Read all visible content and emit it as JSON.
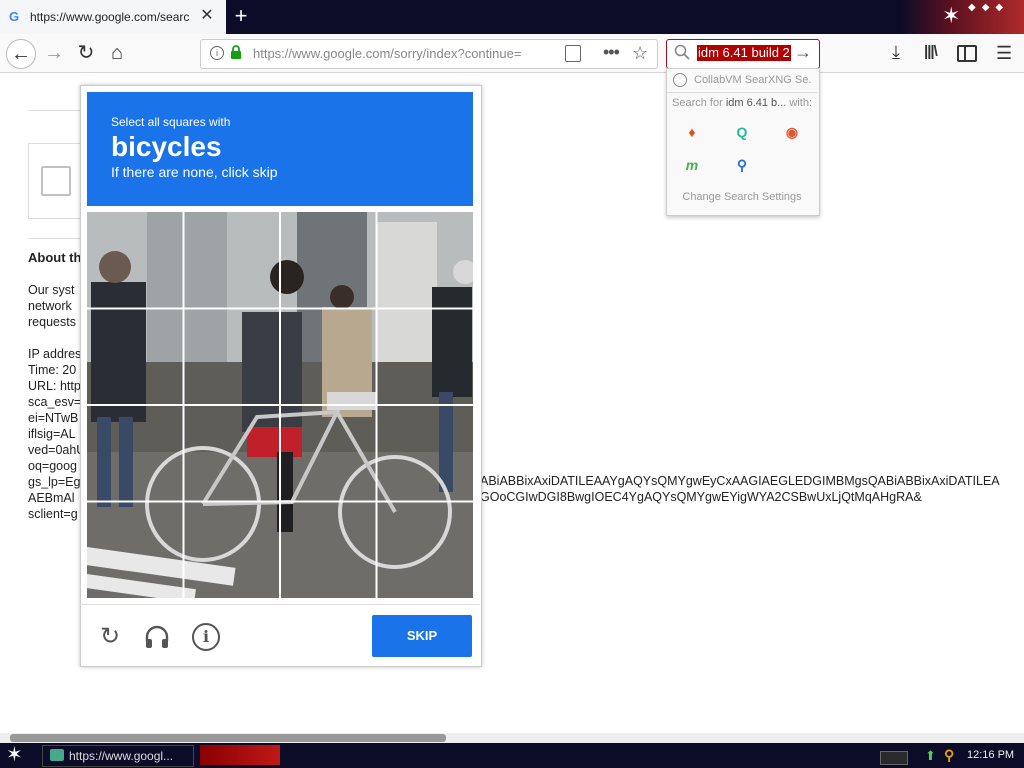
{
  "browser": {
    "tab": {
      "title": "https://www.google.com/search?",
      "favicon": "G",
      "close_label": "✕"
    },
    "new_tab_label": "+",
    "url": "https://www.google.com/sorry/index?continue=",
    "search_box": {
      "value": "idm 6.41 build 2"
    },
    "search_dropdown": {
      "suggestion": "CollabVM SearXNG Se...",
      "search_for_prefix": "Search for ",
      "search_for_term": "idm 6.41 b...",
      "search_for_suffix": " with:",
      "engines": [
        "brave",
        "qwant",
        "duckduckgo",
        "mojeek",
        "searx"
      ],
      "settings_label": "Change Search Settings"
    }
  },
  "page": {
    "about_heading": "About th",
    "lines": [
      "Our syst",
      "network",
      "requests",
      "",
      "IP addres",
      "Time: 20",
      "URL: http",
      "sca_esv=",
      "ei=NTwB",
      "iflsig=AL",
      "ved=0ahU",
      "oq=goog",
      "gs_lp=Eg",
      "AEBmAl",
      "sclient=g"
    ],
    "overflow_line1": "ABiABBixAxiDATILEAAYgAQYsQMYgwEyCxAAGIAEGLEDGIMBMgsQABiABBixAxiDATILEA",
    "overflow_line2": "GOoCGIwDGI8BwgIOEC4YgAQYsQMYgwEYigWYA2CSBwUxLjQtMqAHgRA&"
  },
  "captcha": {
    "instruction": "Select all squares with",
    "target": "bicycles",
    "hint": "If there are none, click skip",
    "skip_label": "SKIP",
    "grid_size": 4,
    "icons": [
      "reload-icon",
      "headphones-icon",
      "info-icon"
    ],
    "accent": "#1a73e8"
  },
  "taskbar": {
    "task_label": "https://www.googl...",
    "clock": "12:16 PM"
  }
}
